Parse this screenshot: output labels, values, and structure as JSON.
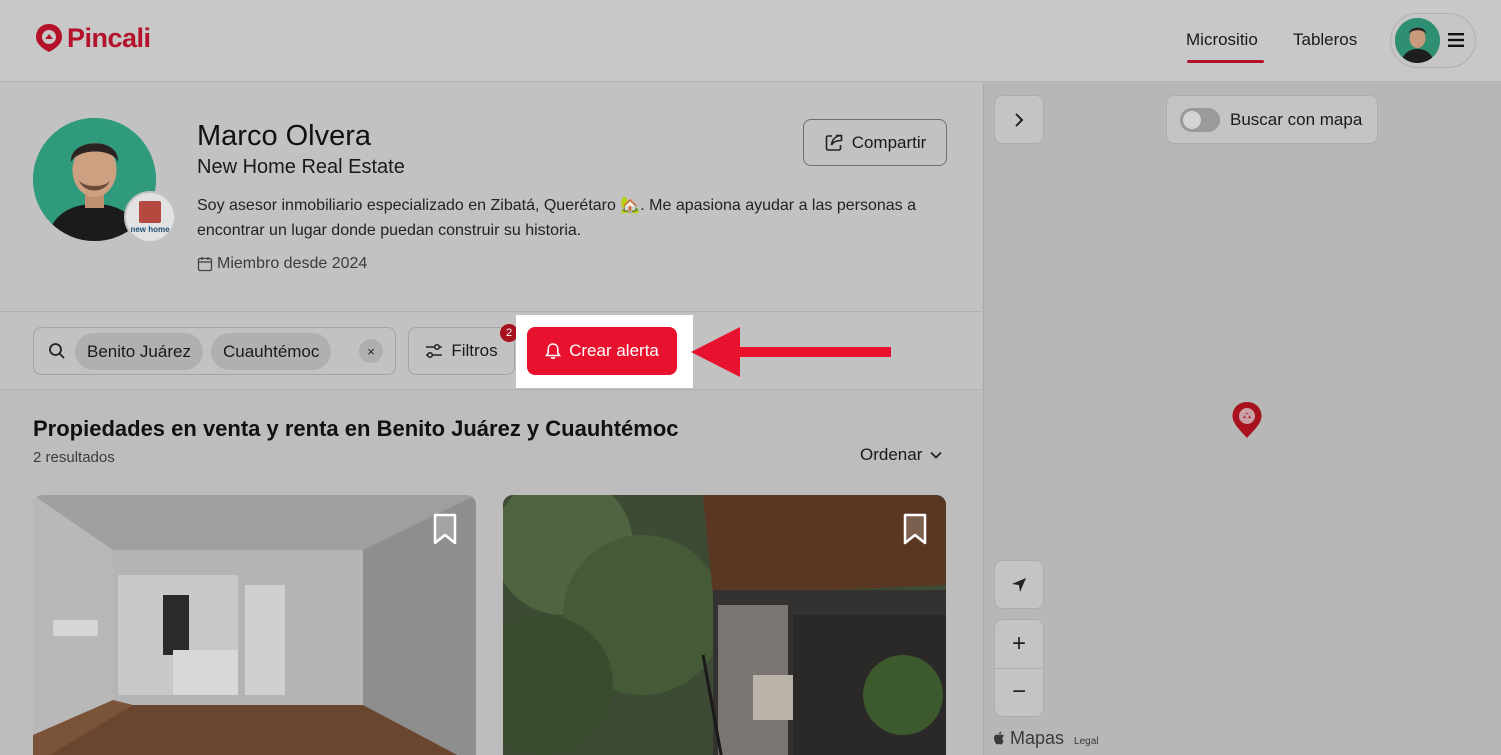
{
  "header": {
    "logo_text": "Pincali",
    "nav": [
      "Micrositio",
      "Tableros"
    ],
    "active_nav": "Micrositio"
  },
  "profile": {
    "name": "Marco Olvera",
    "company": "New Home Real Estate",
    "agency_logo_text": "new home",
    "bio": "Soy asesor inmobiliario especializado en Zibatá, Querétaro 🏡. Me apasiona ayudar a las personas a encontrar un lugar donde puedan construir su historia.",
    "member_since": "Miembro desde 2024",
    "share_label": "Compartir"
  },
  "filters": {
    "chips": [
      "Benito Juárez",
      "Cuauhtémoc"
    ],
    "clear_symbol": "×",
    "filters_label": "Filtros",
    "filters_count": "2",
    "alert_label": "Crear alerta"
  },
  "results": {
    "title": "Propiedades en venta y renta en Benito Juárez y Cuauhtémoc",
    "count": "2 resultados",
    "sort_label": "Ordenar"
  },
  "map": {
    "search_with_map_label": "Buscar con mapa",
    "zoom_in": "+",
    "zoom_out": "−",
    "attribution": "Mapas",
    "legal": "Legal"
  },
  "colors": {
    "brand": "#b4122a",
    "alert_button": "#e8112e",
    "arrow": "#e8112e"
  }
}
